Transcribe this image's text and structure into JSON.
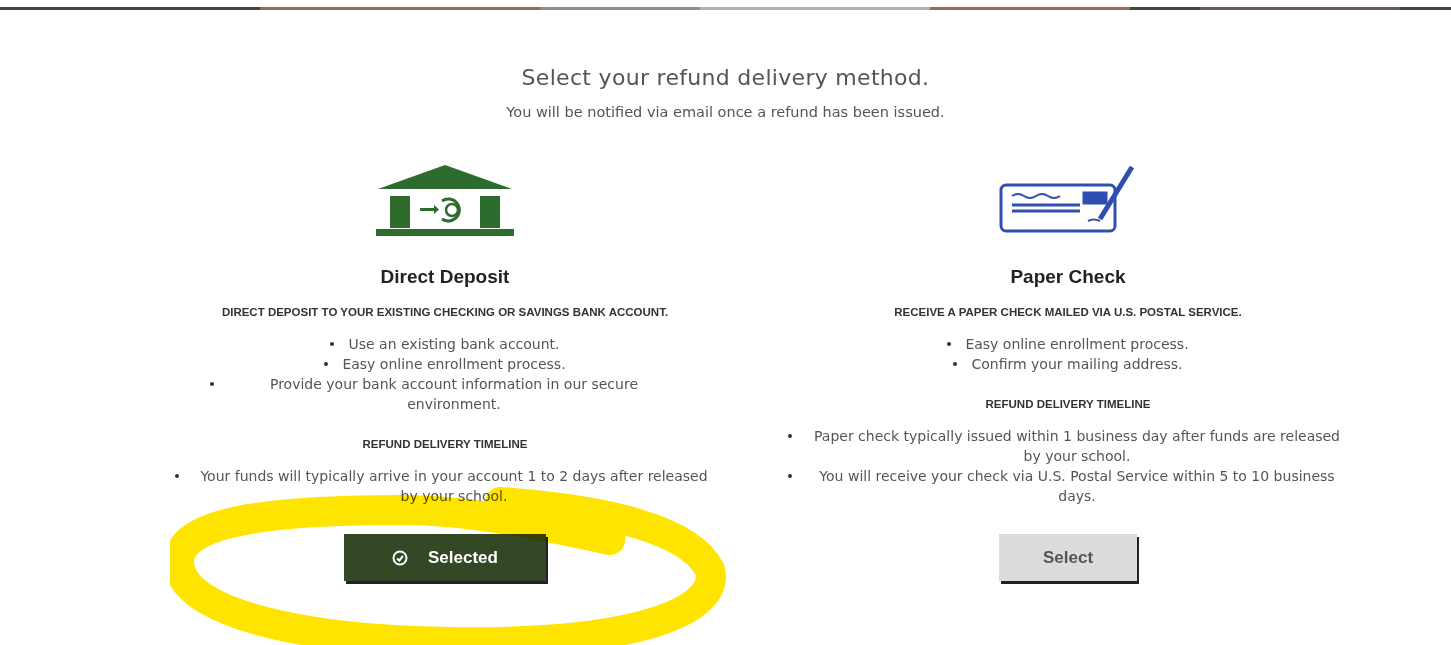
{
  "header": {
    "title": "Select your refund delivery method.",
    "subtitle": "You will be notified via email once a refund has been issued."
  },
  "options": [
    {
      "kind": "bank",
      "title": "Direct Deposit",
      "tagline": "DIRECT DEPOSIT TO YOUR EXISTING CHECKING OR SAVINGS BANK ACCOUNT.",
      "features": [
        "Use an existing bank account.",
        "Easy online enrollment process.",
        "Provide your bank account information in our secure environment."
      ],
      "timeline_heading": "REFUND DELIVERY TIMELINE",
      "timeline": [
        "Your funds will typically arrive in your account 1 to 2 days after released by your school."
      ],
      "button": "Selected",
      "selected": true
    },
    {
      "kind": "check",
      "title": "Paper Check",
      "tagline": "RECEIVE A PAPER CHECK MAILED VIA U.S. POSTAL SERVICE.",
      "features": [
        "Easy online enrollment process.",
        "Confirm your mailing address."
      ],
      "timeline_heading": "REFUND DELIVERY TIMELINE",
      "timeline": [
        "Paper check typically issued within 1 business day after funds are released by your school.",
        "You will receive your check via U.S. Postal Service within 5 to 10 business days."
      ],
      "button": "Select",
      "selected": false
    }
  ],
  "annotation": {
    "kind": "highlight"
  }
}
